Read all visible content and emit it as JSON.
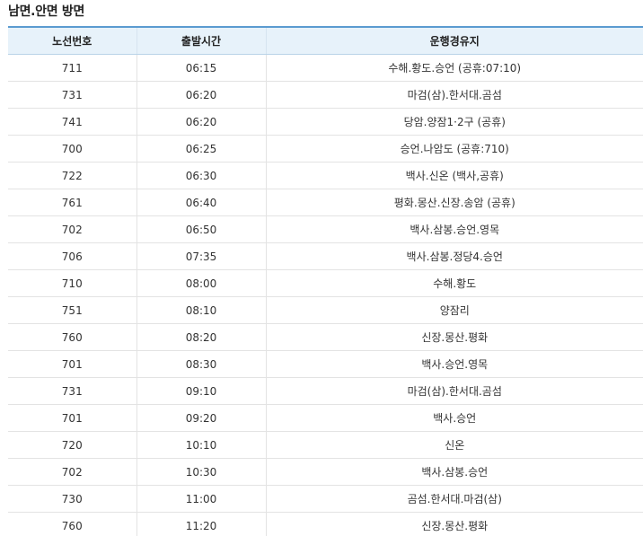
{
  "section": {
    "title": "남면.안면 방면"
  },
  "table": {
    "headers": [
      "노선번호",
      "출발시간",
      "운행경유지"
    ],
    "rows": [
      [
        "711",
        "06:15",
        "수해.황도.승언 (공휴:07:10)"
      ],
      [
        "731",
        "06:20",
        "마검(삼).한서대.곰섬"
      ],
      [
        "741",
        "06:20",
        "당암.양잠1·2구 (공휴)"
      ],
      [
        "700",
        "06:25",
        "승언.나암도 (공휴:710)"
      ],
      [
        "722",
        "06:30",
        "백사.신온 (백사,공휴)"
      ],
      [
        "761",
        "06:40",
        "평화.몽산.신장.송암 (공휴)"
      ],
      [
        "702",
        "06:50",
        "백사.삼봉.승언.영목"
      ],
      [
        "706",
        "07:35",
        "백사.삼봉.정당4.승언"
      ],
      [
        "710",
        "08:00",
        "수해.황도"
      ],
      [
        "751",
        "08:10",
        "양잠리"
      ],
      [
        "760",
        "08:20",
        "신장.몽산.평화"
      ],
      [
        "701",
        "08:30",
        "백사.승언.영목"
      ],
      [
        "731",
        "09:10",
        "마검(삼).한서대.곰섬"
      ],
      [
        "701",
        "09:20",
        "백사.승언"
      ],
      [
        "720",
        "10:10",
        "신온"
      ],
      [
        "702",
        "10:30",
        "백사.삼봉.승언"
      ],
      [
        "730",
        "11:00",
        "곰섬.한서대.마검(삼)"
      ],
      [
        "760",
        "11:20",
        "신장.몽산.평화"
      ]
    ]
  }
}
